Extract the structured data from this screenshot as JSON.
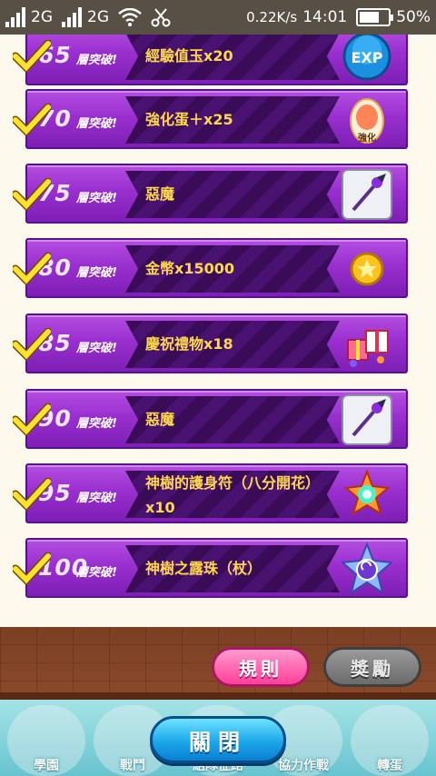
{
  "status_bar": {
    "network1": "2G",
    "network2": "2G",
    "speed": "0.22K/s",
    "time": "14:01",
    "battery": "50%"
  },
  "level_suffix": "層突破!",
  "rewards": [
    {
      "level": "65",
      "name": "經驗值玉x20",
      "icon": "exp-orb-icon"
    },
    {
      "level": "70",
      "name": "強化蛋＋x25",
      "icon": "enhance-egg-icon",
      "icon_label": "強化"
    },
    {
      "level": "75",
      "name": "惡魔",
      "icon": "demon-staff-icon"
    },
    {
      "level": "80",
      "name": "金幣x15000",
      "icon": "gold-coin-icon"
    },
    {
      "level": "85",
      "name": "慶祝禮物x18",
      "icon": "gift-box-icon"
    },
    {
      "level": "90",
      "name": "惡魔",
      "icon": "demon-staff-icon"
    },
    {
      "level": "95",
      "name": "神樹的護身符（八分開花）x10",
      "icon": "sacred-tree-amulet-icon"
    },
    {
      "level": "100",
      "name": "神樹之露珠（杖）",
      "icon": "sacred-tree-dewdrop-icon"
    }
  ],
  "buttons": {
    "rules": "規則",
    "reward": "獎勵",
    "close": "關閉"
  },
  "nav": [
    "學園",
    "戰鬥",
    "組隊征路",
    "協力作戰",
    "轉蛋"
  ],
  "exp_label": "EXP"
}
